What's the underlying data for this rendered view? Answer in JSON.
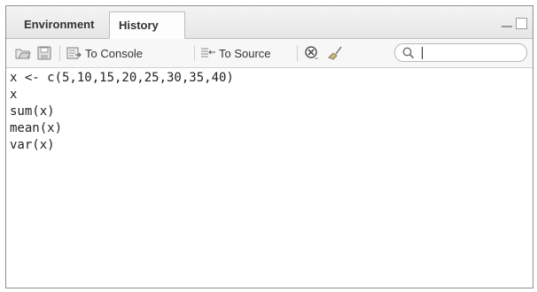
{
  "tabs": [
    {
      "label": "Environment",
      "active": false
    },
    {
      "label": "History",
      "active": true
    }
  ],
  "toolbar": {
    "load_icon": "open-folder-icon",
    "save_icon": "save-disk-icon",
    "to_console_label": "To Console",
    "to_source_label": "To Source",
    "remove_icon": "delete-entry-icon",
    "clear_icon": "broom-icon"
  },
  "search": {
    "placeholder": "",
    "value": ""
  },
  "history": [
    "x <- c(5,10,15,20,25,30,35,40)",
    "x",
    "sum(x)",
    "mean(x)",
    "var(x)"
  ]
}
